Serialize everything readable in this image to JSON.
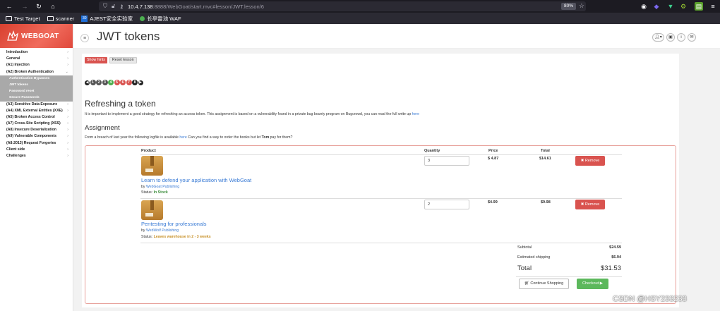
{
  "browser": {
    "url_host": "10.4.7.138",
    "url_rest": ":8888/WebGoat/start.mvc#lesson/JWT.lesson/6",
    "zoom": "80%",
    "bookmarks": [
      {
        "label": "Test Target",
        "icon": "folder-icon"
      },
      {
        "label": "scanner",
        "icon": "folder-icon"
      },
      {
        "label": "AJEST安全实验室",
        "icon": "ajest-icon"
      },
      {
        "label": "长亭雷池 WAF",
        "icon": "waf-icon"
      }
    ]
  },
  "app": {
    "logo": "WEBGOAT",
    "page_title": "JWT tokens",
    "menu": [
      "Introduction",
      "General",
      "(A1) Injection",
      "(A2) Broken Authentication"
    ],
    "submenu": [
      "Authentication Bypasses",
      "JWT tokens",
      "Password reset",
      "Secure Passwords"
    ],
    "menu_after": [
      "(A3) Sensitive Data Exposure",
      "(A4) XML External Entities (XXE)",
      "(A5) Broken Access Control",
      "(A7) Cross-Site Scripting (XSS)",
      "(A8) Insecure Deserialization",
      "(A9) Vulnerable Components",
      "(A8:2013) Request Forgeries",
      "Client side",
      "Challenges"
    ]
  },
  "lesson": {
    "show_hints": "Show hints",
    "reset_lesson": "Reset lesson",
    "pages": [
      {
        "n": "1",
        "color": "#555555"
      },
      {
        "n": "2",
        "color": "#555555"
      },
      {
        "n": "3",
        "color": "#555555"
      },
      {
        "n": "4",
        "color": "#4cae4c"
      },
      {
        "n": "5",
        "color": "#d9534f"
      },
      {
        "n": "6",
        "color": "#d9534f"
      },
      {
        "n": "7",
        "color": "#d9534f"
      },
      {
        "n": "8",
        "color": "#222222"
      }
    ],
    "heading": "Refreshing a token",
    "intro": "It is important to implement a good strategy for refreshing an access token. This assignment is based on a vulnerability found in a private bug bounty program on Bugcrowd, you can read the full write up",
    "intro_link": "here",
    "assignment_heading": "Assignment",
    "assignment_pre": "From a breach of last year the following logfile is available",
    "assignment_link": "here",
    "assignment_mid": "Can you find a way to order the books but let",
    "assignment_bold": "Tom",
    "assignment_post": "pay for them?"
  },
  "cart": {
    "headers": {
      "product": "Product",
      "quantity": "Quantity",
      "price": "Price",
      "total": "Total"
    },
    "items": [
      {
        "name": "Learn to defend your application with WebGoat",
        "by": "by",
        "publisher": "WebGoat Publishing",
        "status_label": "Status:",
        "status": "In Stock",
        "status_color": "#3c8d3c",
        "quantity": "3",
        "price": "$ 4.87",
        "total": "$14.61",
        "remove": "Remove"
      },
      {
        "name": "Pentesting for professionals",
        "by": "by",
        "publisher": "WebWolf Publishing",
        "status_label": "Status:",
        "status": "Leaves warehouse in 2 - 3 weeks",
        "status_color": "#c8922a",
        "quantity": "2",
        "price": "$4.99",
        "total": "$9.98",
        "remove": "Remove"
      }
    ],
    "subtotal_label": "Subtotal",
    "subtotal": "$24.59",
    "shipping_label": "Estimated shipping",
    "shipping": "$6.94",
    "total_label": "Total",
    "total": "$31.53",
    "continue_label": "Continue Shopping",
    "checkout_label": "Checkout"
  },
  "watermark": "CSDN @HSY233233"
}
